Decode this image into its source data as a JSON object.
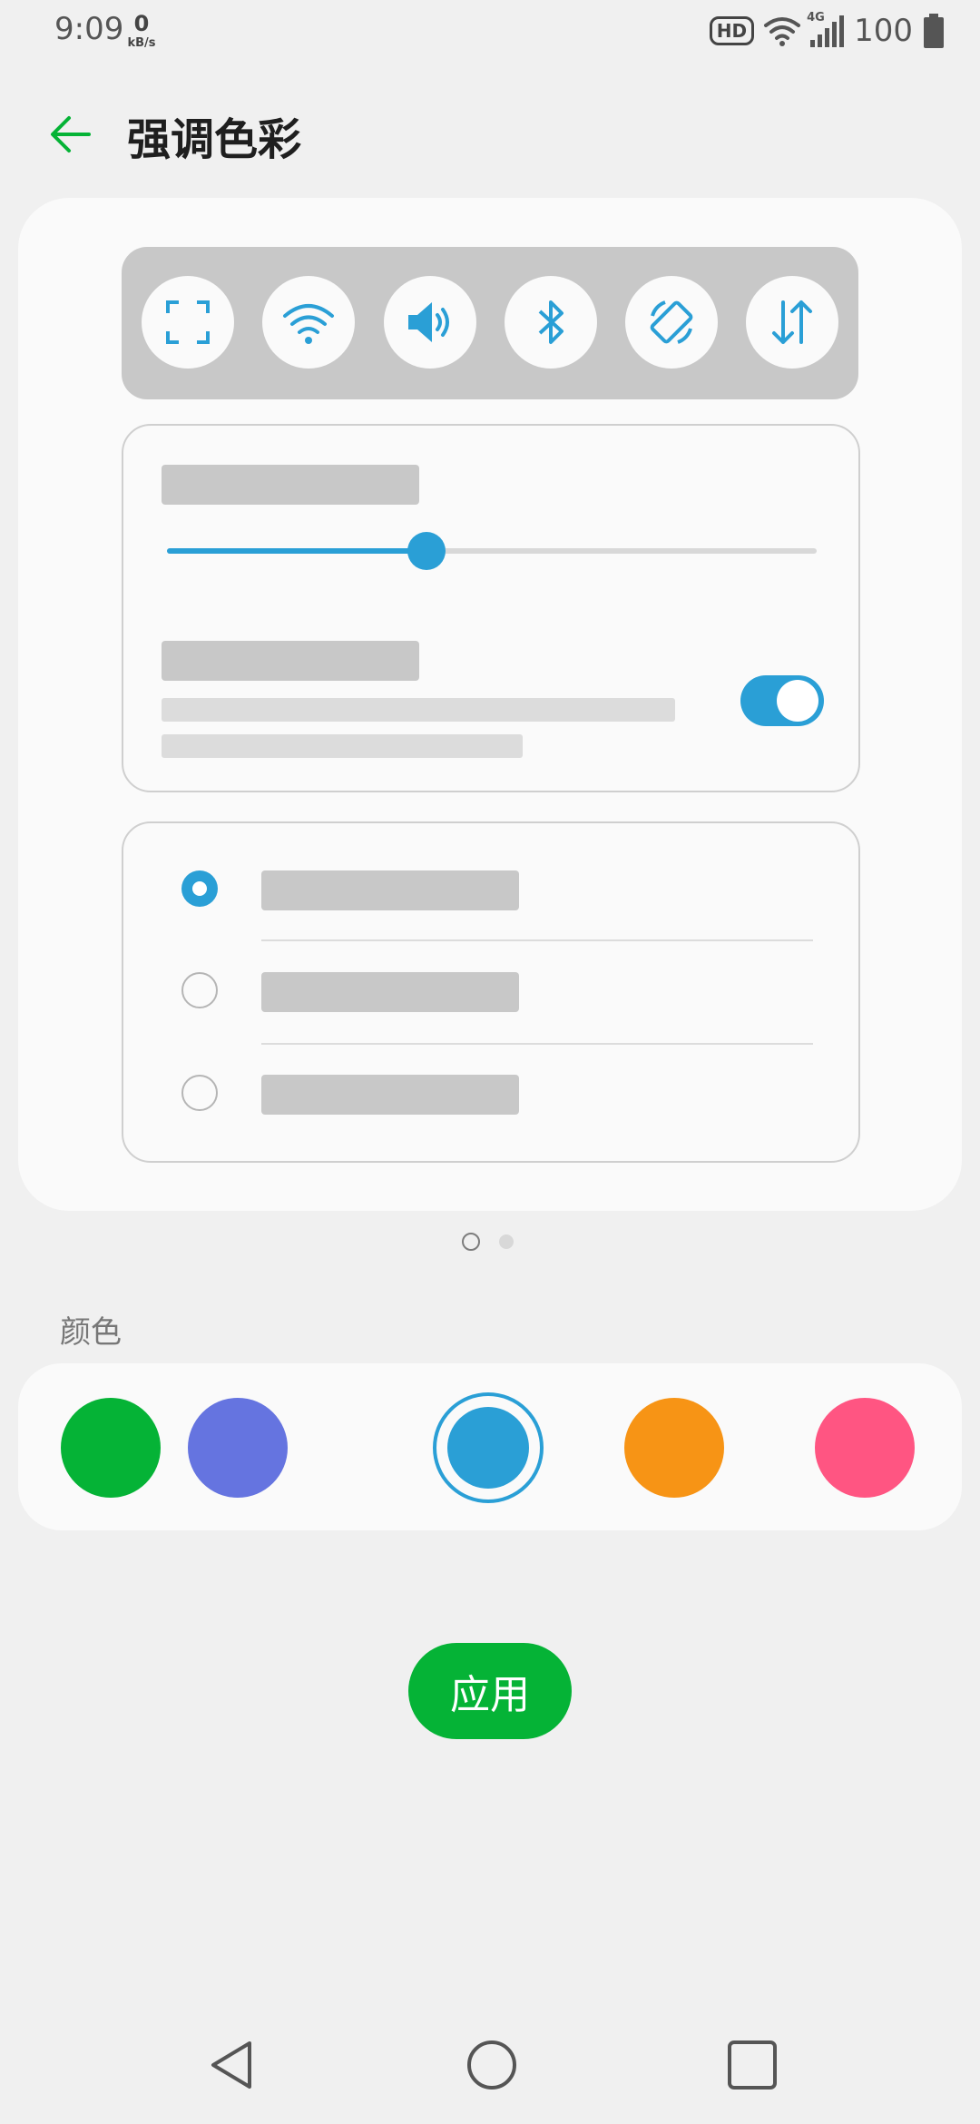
{
  "status_bar": {
    "time": "9:09",
    "net_speed_value": "0",
    "net_speed_unit": "kB/s",
    "hd_label": "HD",
    "network_label": "4G",
    "battery_level": "100"
  },
  "header": {
    "title": "强调色彩",
    "back_icon": "arrow-left-icon"
  },
  "preview": {
    "quick_settings_icons": [
      "screenshot-icon",
      "wifi-icon",
      "volume-icon",
      "bluetooth-icon",
      "auto-rotate-icon",
      "mobile-data-icon"
    ],
    "slider_level": 0.4,
    "toggle_on": true,
    "radio_options_count": 3,
    "radio_selected_index": 0,
    "accent_color": "#2a9fd6"
  },
  "pager": {
    "page_count": 2,
    "current_page": 1
  },
  "colors_section": {
    "label": "颜色",
    "swatches": [
      {
        "name": "green",
        "color": "#05b336"
      },
      {
        "name": "indigo",
        "color": "#6574e0"
      },
      {
        "name": "blue",
        "color": "#2a9fd6"
      },
      {
        "name": "orange",
        "color": "#f79415"
      },
      {
        "name": "pink",
        "color": "#ff5582"
      }
    ],
    "selected_index": 2
  },
  "apply_button": {
    "label": "应用",
    "color": "#05b336"
  },
  "nav_bar": {
    "icons": [
      "nav-back-icon",
      "nav-home-icon",
      "nav-recents-icon"
    ]
  }
}
